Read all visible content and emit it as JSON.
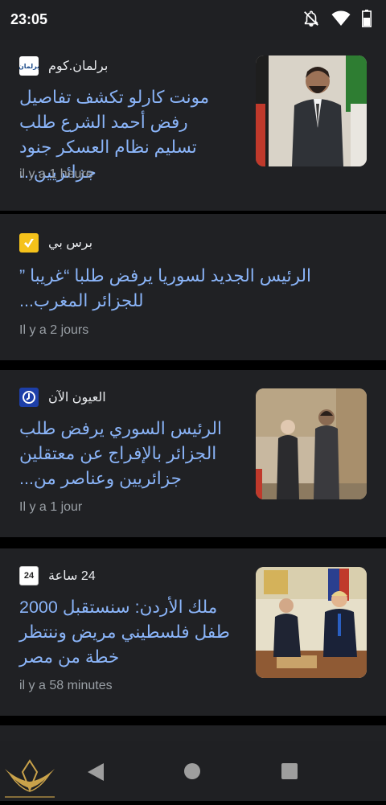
{
  "status_bar": {
    "time": "23:05"
  },
  "articles": [
    {
      "source": "برلمان.كوم",
      "favicon_text": "برلمان",
      "headline": "مونت كارلو تكشف تفاصيل رفض أحمد الشرع طلب تسليم نظام العسكر جنود جزائريين...",
      "time": "il y a 1 heure",
      "has_image": true
    },
    {
      "source": "برس بي",
      "headline": "الرئيس الجديد لسوريا يرفض طلبا “غريبا ” للجزائر المغرب...",
      "time": "Il y a 2 jours",
      "has_image": false
    },
    {
      "source": "العيون الآن",
      "headline": "الرئيس السوري يرفض طلب الجزائر بالإفراج عن معتقلين جزائريين وعناصر من...",
      "time": "Il y a 1 jour",
      "has_image": true
    },
    {
      "source": "24 ساعة",
      "favicon_text": "24",
      "headline": "ملك الأردن: سنستقبل 2000 طفل فلسطيني مريض وننتظر خطة من مصر",
      "time": "il y a 58 minutes",
      "has_image": true
    }
  ],
  "colors": {
    "background": "#000000",
    "card": "#202124",
    "headline": "#8ab4f8",
    "timestamp": "#9aa0a6",
    "source": "#e8eaed"
  },
  "icons": {
    "status": [
      "notifications-off-icon",
      "wifi-icon",
      "battery-icon"
    ],
    "nav": [
      "back-icon",
      "home-icon",
      "recents-icon"
    ]
  }
}
